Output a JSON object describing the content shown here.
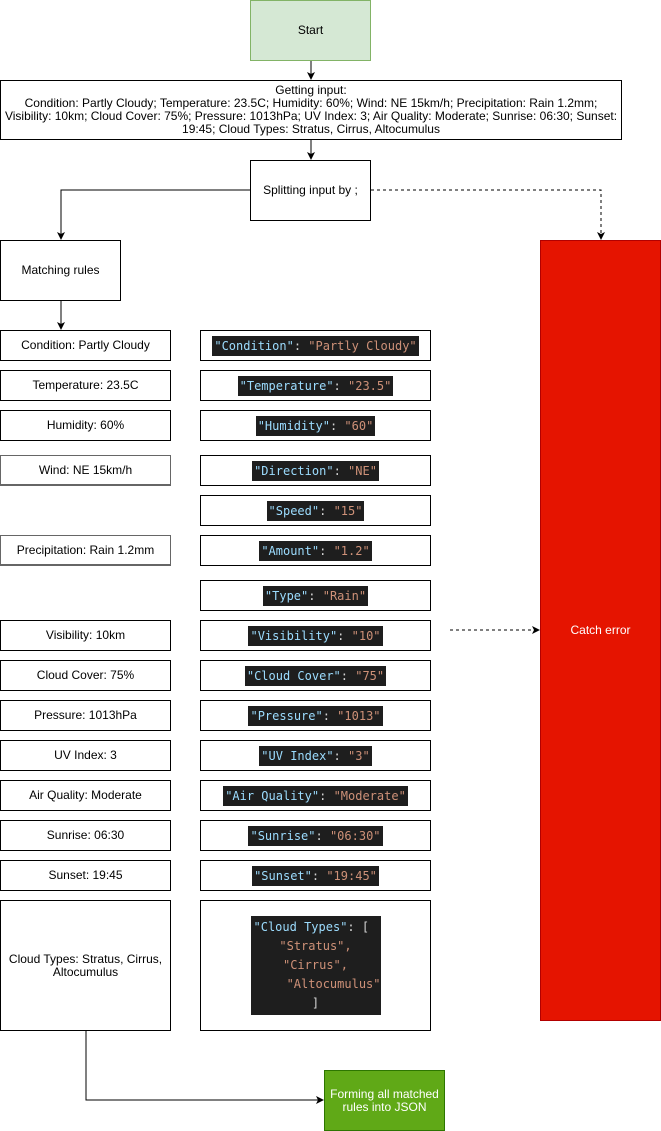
{
  "nodes": {
    "start": "Start",
    "input_title": "Getting input:",
    "input_text": "Condition: Partly Cloudy; Temperature: 23.5C; Humidity: 60%; Wind: NE 15km/h; Precipitation: Rain 1.2mm; Visibility: 10km; Cloud Cover: 75%; Pressure: 1013hPa; UV Index: 3; Air Quality: Moderate; Sunrise: 06:30; Sunset: 19:45; Cloud Types: Stratus, Cirrus, Altocumulus",
    "split": "Splitting input by ;",
    "matching": "Matching rules",
    "catch": "Catch error",
    "final": "Forming all matched rules into JSON"
  },
  "rules": [
    "Condition: Partly Cloudy",
    "Temperature: 23.5C",
    "Humidity: 60%",
    "Wind: NE 15km/h",
    "Precipitation: Rain 1.2mm",
    "Visibility: 10km",
    "Cloud Cover: 75%",
    "Pressure: 1013hPa",
    "UV Index: 3",
    "Air Quality: Moderate",
    "Sunrise: 06:30",
    "Sunset: 19:45",
    "Cloud Types: Stratus, Cirrus, Altocumulus"
  ],
  "json_pairs": [
    {
      "key": "\"Condition\"",
      "sep": ": ",
      "value": "\"Partly Cloudy\""
    },
    {
      "key": "\"Temperature\"",
      "sep": ": ",
      "value": "\"23.5\""
    },
    {
      "key": "\"Humidity\"",
      "sep": ": ",
      "value": "\"60\""
    },
    {
      "key": "\"Direction\"",
      "sep": ": ",
      "value": "\"NE\""
    },
    {
      "key": "\"Speed\"",
      "sep": ": ",
      "value": "\"15\""
    },
    {
      "key": "\"Amount\"",
      "sep": ": ",
      "value": "\"1.2\""
    },
    {
      "key": "\"Type\"",
      "sep": ": ",
      "value": "\"Rain\""
    },
    {
      "key": "\"Visibility\"",
      "sep": ": ",
      "value": "\"10\""
    },
    {
      "key": "\"Cloud Cover\"",
      "sep": ": ",
      "value": "\"75\""
    },
    {
      "key": "\"Pressure\"",
      "sep": ": ",
      "value": "\"1013\""
    },
    {
      "key": "\"UV Index\"",
      "sep": ": ",
      "value": "\"3\""
    },
    {
      "key": "\"Air Quality\"",
      "sep": ": ",
      "value": "\"Moderate\""
    },
    {
      "key": "\"Sunrise\"",
      "sep": ": ",
      "value": "\"06:30\""
    },
    {
      "key": "\"Sunset\"",
      "sep": ": ",
      "value": "\"19:45\""
    }
  ],
  "cloud_types_json": {
    "key": "\"Cloud Types\"",
    "sep": ": ",
    "open": "[",
    "items": [
      "\"Stratus\",",
      "\"Cirrus\",",
      "\"Altocumulus\""
    ],
    "close": "]"
  },
  "colors": {
    "start_fill": "#d5e8d4",
    "start_border": "#82b366",
    "final_fill": "#60a917",
    "error_fill": "#e51400",
    "code_bg": "#1e1e1e",
    "code_key": "#9cdcfe",
    "code_value": "#ce9178"
  }
}
